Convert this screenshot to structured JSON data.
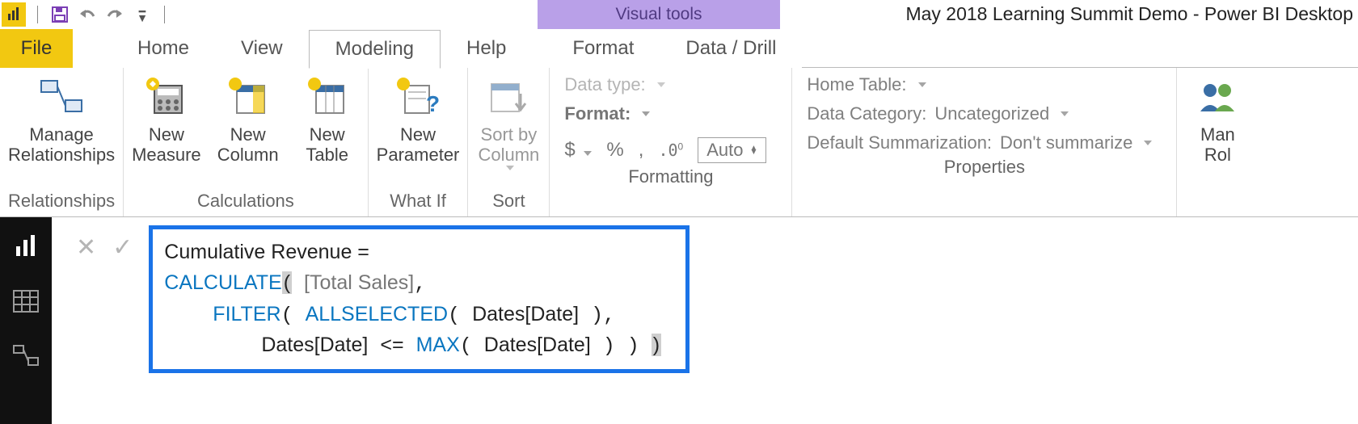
{
  "title_bar": {
    "visual_tools_label": "Visual tools",
    "window_title": "May 2018 Learning Summit Demo - Power BI Desktop"
  },
  "tabs": {
    "file": "File",
    "home": "Home",
    "view": "View",
    "modeling": "Modeling",
    "help": "Help",
    "format": "Format",
    "data_drill": "Data / Drill"
  },
  "ribbon": {
    "relationships": {
      "manage": "Manage\nRelationships",
      "group_label": "Relationships"
    },
    "calculations": {
      "new_measure": "New\nMeasure",
      "new_column": "New\nColumn",
      "new_table": "New\nTable",
      "group_label": "Calculations"
    },
    "whatif": {
      "new_parameter": "New\nParameter",
      "group_label": "What If"
    },
    "sort": {
      "sort_by_column": "Sort by\nColumn",
      "group_label": "Sort"
    },
    "formatting": {
      "data_type_label": "Data type:",
      "format_label": "Format:",
      "currency": "$",
      "percent": "%",
      "thousands": ",",
      "decimals_icon": ".0⁰₀",
      "auto": "Auto",
      "group_label": "Formatting"
    },
    "properties": {
      "home_table": "Home Table:",
      "data_category_label": "Data Category:",
      "data_category_value": "Uncategorized",
      "default_summ_label": "Default Summarization:",
      "default_summ_value": "Don't summarize",
      "group_label": "Properties"
    },
    "security": {
      "manage_roles": "Man\nRol"
    }
  },
  "formula": {
    "line1_plain": "Cumulative Revenue =",
    "calc": "CALCULATE",
    "total_sales": "[Total Sales]",
    "filter": "FILTER",
    "allselected": "ALLSELECTED",
    "dates_date": "Dates[Date]",
    "max": "MAX",
    "lte": "<="
  }
}
